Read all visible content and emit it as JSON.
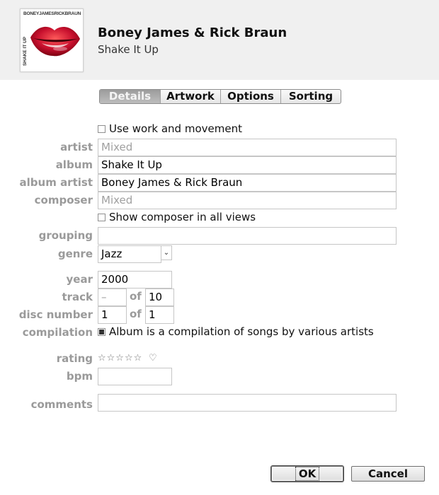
{
  "header": {
    "artist": "Boney James & Rick Braun",
    "album": "Shake It Up",
    "artwork_text_top": "BONEYJAMESRICKBRAUN",
    "artwork_text_side": "SHAKE IT UP"
  },
  "tabs": [
    {
      "label": "Details",
      "active": true
    },
    {
      "label": "Artwork",
      "active": false
    },
    {
      "label": "Options",
      "active": false
    },
    {
      "label": "Sorting",
      "active": false
    }
  ],
  "form": {
    "use_work_label": "Use work and movement",
    "use_work_checked": false,
    "artist_label": "artist",
    "artist_value": "Mixed",
    "album_label": "album",
    "album_value": "Shake It Up",
    "album_artist_label": "album artist",
    "album_artist_value": "Boney James & Rick Braun",
    "composer_label": "composer",
    "composer_value": "Mixed",
    "show_composer_label": "Show composer in all views",
    "show_composer_checked": false,
    "grouping_label": "grouping",
    "grouping_value": "",
    "genre_label": "genre",
    "genre_value": "Jazz",
    "year_label": "year",
    "year_value": "2000",
    "track_label": "track",
    "track_value": "–",
    "track_of_label": "of",
    "track_total": "10",
    "disc_label": "disc number",
    "disc_value": "1",
    "disc_of_label": "of",
    "disc_total": "1",
    "compilation_label": "compilation",
    "compilation_text": "Album is a compilation of songs by various artists",
    "compilation_checked": true,
    "rating_label": "rating",
    "rating_stars": "☆☆☆☆☆",
    "rating_value": 0,
    "love_icon": "♡",
    "bpm_label": "bpm",
    "bpm_value": "",
    "comments_label": "comments",
    "comments_value": ""
  },
  "buttons": {
    "ok": "OK",
    "cancel": "Cancel"
  },
  "colors": {
    "header_bg": "#f0f0f0",
    "label_gray": "#9a9a9a",
    "lips_red": "#c8102e"
  }
}
